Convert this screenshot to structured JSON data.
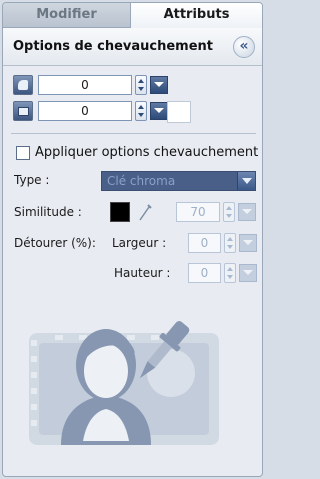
{
  "tabs": [
    {
      "label": "Modifier",
      "active": false
    },
    {
      "label": "Attributs",
      "active": true
    }
  ],
  "header": {
    "title": "Options de chevauchement",
    "collapse_glyph": "«"
  },
  "controls": {
    "row1": {
      "icon": "mask-shape-icon",
      "value": "0"
    },
    "row2": {
      "icon": "frame-icon",
      "value": "0"
    }
  },
  "apply_overlay": {
    "label": "Appliquer options chevauchement",
    "checked": false
  },
  "type": {
    "label": "Type :",
    "selected": "Clé chroma"
  },
  "similarity": {
    "label": "Similitude :",
    "color": "#000000",
    "value": "70"
  },
  "crop": {
    "label": "Détourer (%):",
    "width_label": "Largeur :",
    "width_value": "0",
    "height_label": "Hauteur :",
    "height_value": "0"
  },
  "colors": {
    "accent": "#2d4a78",
    "disabled_select": "#4a5f88",
    "panel_bg": "#e8ecf2"
  }
}
